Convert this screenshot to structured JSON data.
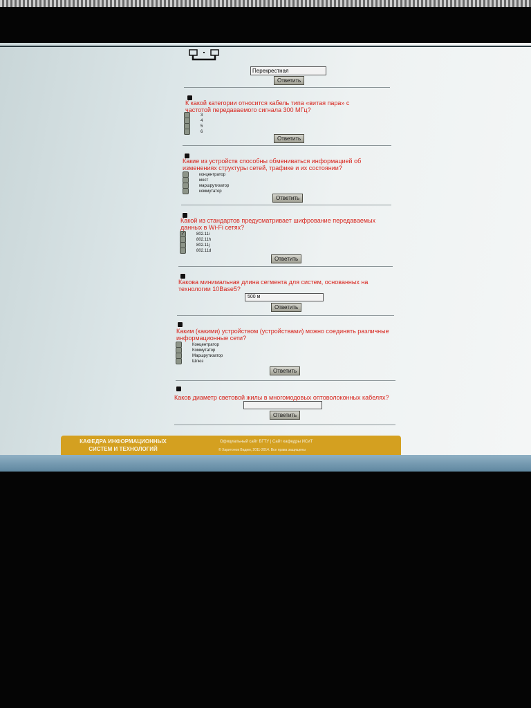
{
  "search": {
    "value": "Перекрестная",
    "button": "Ответить"
  },
  "questions": [
    {
      "text": "К какой категории относится кабель типа «витая пара» с частотой передаваемого сигнала 300 МГц?",
      "options": [
        "3",
        "4",
        "5",
        "6"
      ],
      "button": "Ответить"
    },
    {
      "text": "Какие из устройств способны обмениваться информацией об изменениях структуры сетей, трафике и их состоянии?",
      "options": [
        "концентратор",
        "мост",
        "маршрутизатор",
        "коммутатор"
      ],
      "button": "Ответить"
    },
    {
      "text": "Какой из стандартов предусматривает шифрование передаваемых данных в Wi-Fi сетях?",
      "options": [
        "802.11i",
        "802.11h",
        "802.11j",
        "802.11d"
      ],
      "checked": "802.11i",
      "button": "Ответить"
    },
    {
      "text": "Какова минимальная длина сегмента для систем, основанных на технологии 10Base5?",
      "answer": "500 м",
      "button": "Ответить"
    },
    {
      "text": "Каким (какими) устройством (устройствами) можно соединять различные информационные сети?",
      "options": [
        "Концентратор",
        "Коммутатор",
        "Маршрутизатор",
        "Шлюз"
      ],
      "button": "Ответить"
    },
    {
      "text": "Каков диаметр световой жилы в многомодовых оптоволоконных кабелях?",
      "answer": "",
      "button": "Ответить"
    }
  ],
  "footer": {
    "department": "КАФЕДРА ИНФОРМАЦИОННЫХ СИСТЕМ И ТЕХНОЛОГИЙ",
    "links": "Официальный сайт БГТУ | Сайт кафедры ИСиТ",
    "copyright": "© Харитонов Вадим, 2011-2014. Все права защищены"
  },
  "colors": {
    "question": "#d8241c",
    "footer_bg": "#d4a020",
    "footer_text": "#f7f2e2"
  }
}
